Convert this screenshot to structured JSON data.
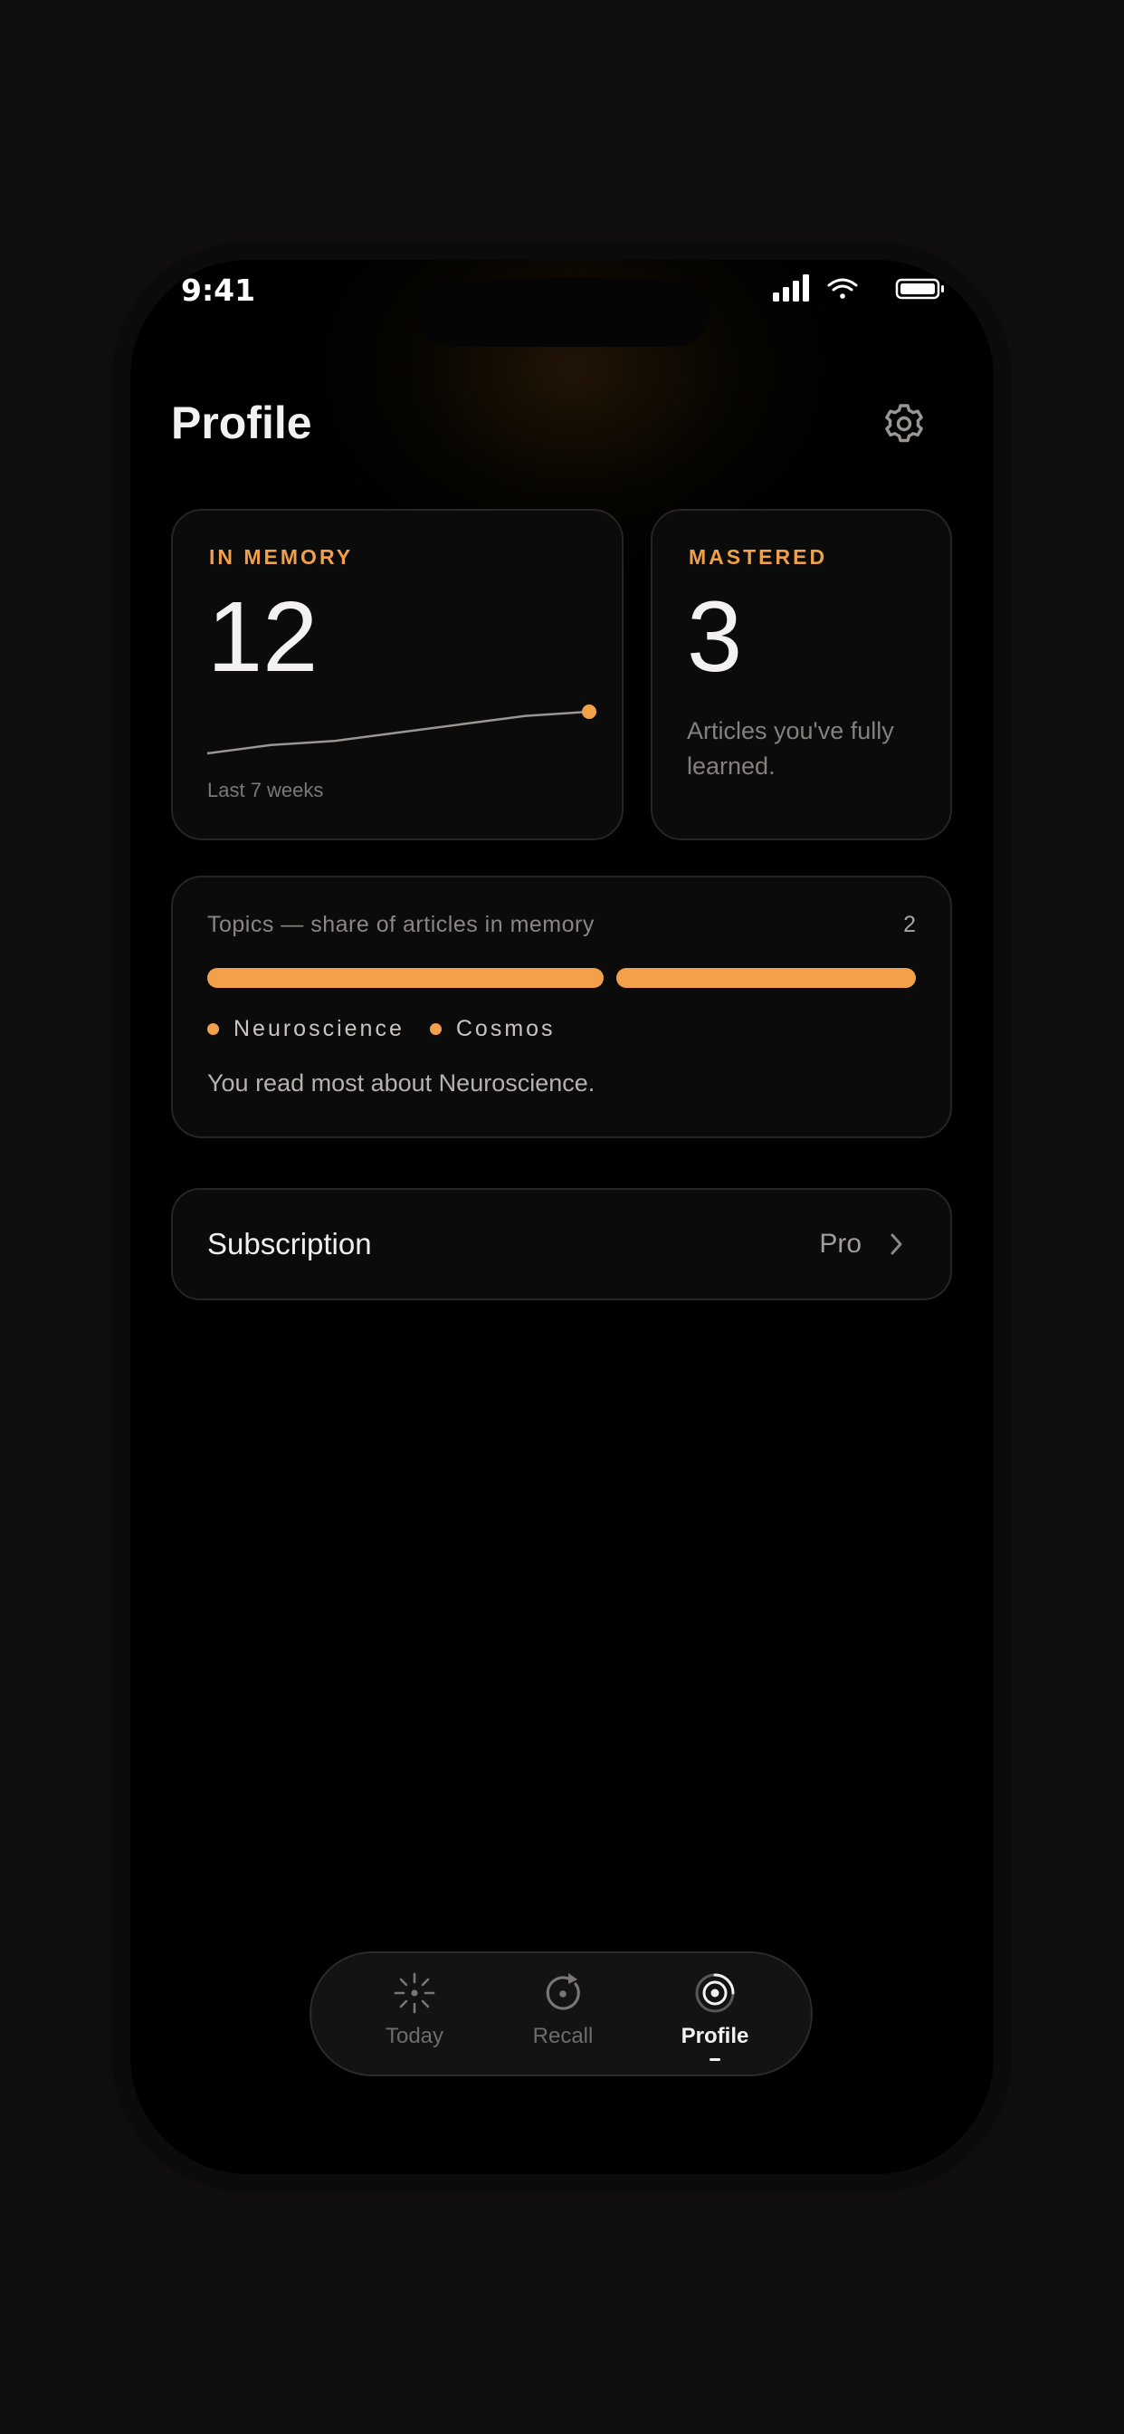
{
  "status_bar": {
    "time": "9:41"
  },
  "header": {
    "title": "Profile",
    "settings_icon": "gear-icon"
  },
  "stats": {
    "in_memory": {
      "label": "IN MEMORY",
      "value": "12",
      "caption": "Last 7 weeks",
      "trend": [
        0,
        1,
        1.5,
        2.5,
        3.5,
        4.5,
        5
      ]
    },
    "mastered": {
      "label": "MASTERED",
      "value": "3",
      "description": "Articles you've fully learned."
    }
  },
  "topics": {
    "header": "Topics — share of articles in memory",
    "count": "2",
    "items": [
      {
        "label": "Neuroscience",
        "share": 0.57
      },
      {
        "label": "Cosmos",
        "share": 0.43
      }
    ],
    "summary": "You read most about Neuroscience."
  },
  "subscription": {
    "label": "Subscription",
    "value": "Pro"
  },
  "tabbar": {
    "tabs": [
      {
        "label": "Today",
        "icon": "sun-icon",
        "active": false
      },
      {
        "label": "Recall",
        "icon": "recall-icon",
        "active": false
      },
      {
        "label": "Profile",
        "icon": "profile-rings-icon",
        "active": true
      }
    ]
  },
  "colors": {
    "accent": "#f2a04a",
    "background": "#000000",
    "card": "#0b0b0b"
  }
}
